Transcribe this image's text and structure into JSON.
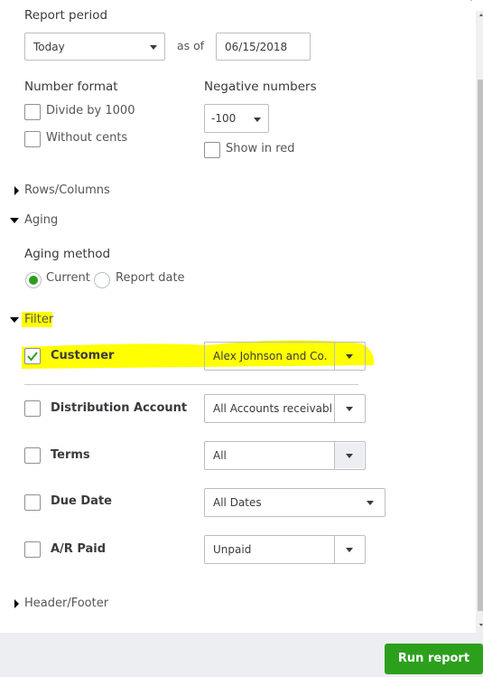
{
  "report_period": {
    "label": "Report period",
    "period_value": "Today",
    "as_of_label": "as of",
    "date_value": "06/15/2018"
  },
  "number_format": {
    "label": "Number format",
    "options": [
      {
        "label": "Divide by 1000",
        "checked": false
      },
      {
        "label": "Without cents",
        "checked": false
      }
    ]
  },
  "negative_numbers": {
    "label": "Negative numbers",
    "value": "-100",
    "show_in_red_label": "Show in red"
  },
  "sections": {
    "rows_columns": "Rows/Columns",
    "aging": "Aging",
    "filter": "Filter",
    "header_footer": "Header/Footer"
  },
  "aging": {
    "method_label": "Aging method",
    "options": [
      {
        "label": "Current",
        "selected": true
      },
      {
        "label": "Report date",
        "selected": false
      }
    ]
  },
  "filters": [
    {
      "label": "Customer",
      "checked": true,
      "value": "Alex Johnson and Co."
    },
    {
      "label": "Distribution Account",
      "checked": false,
      "value": "All Accounts receivabl"
    },
    {
      "label": "Terms",
      "checked": false,
      "value": "All"
    },
    {
      "label": "Due Date",
      "checked": false,
      "value": "All Dates"
    },
    {
      "label": "A/R Paid",
      "checked": false,
      "value": "Unpaid"
    }
  ],
  "footer": {
    "run_report_label": "Run report"
  },
  "colors": {
    "accent_green": "#2ca01c",
    "highlight": "#ffff00"
  }
}
